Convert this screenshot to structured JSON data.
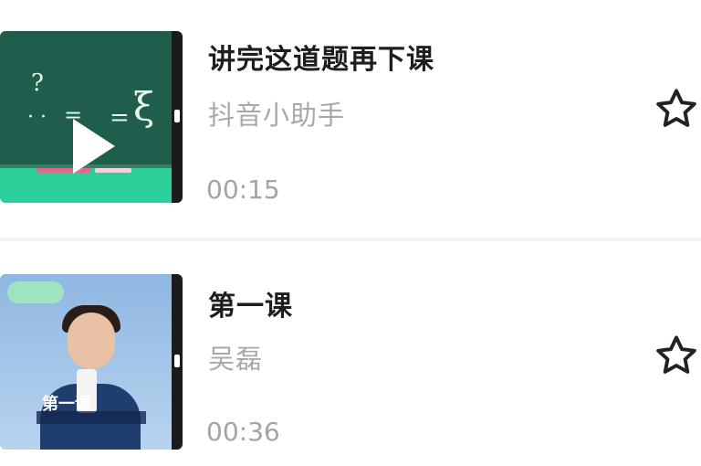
{
  "items": [
    {
      "title": "讲完这道题再下课",
      "author": "抖音小助手",
      "duration": "00:15",
      "thumbnail_icon": "chalkboard-play-icon",
      "chalk_text": [
        "?",
        "=",
        "="
      ],
      "favorited": false
    },
    {
      "title": "第一课",
      "author": "吴磊",
      "duration": "00:36",
      "thumbnail_icon": "person-portrait",
      "caption": "第一课",
      "favorited": false
    }
  ],
  "colors": {
    "title": "#1e1e1e",
    "secondary_text": "#a8a8a8",
    "star_outline": "#222222",
    "board": "#1f5e4c",
    "board_accent": "#2bcf9a"
  }
}
